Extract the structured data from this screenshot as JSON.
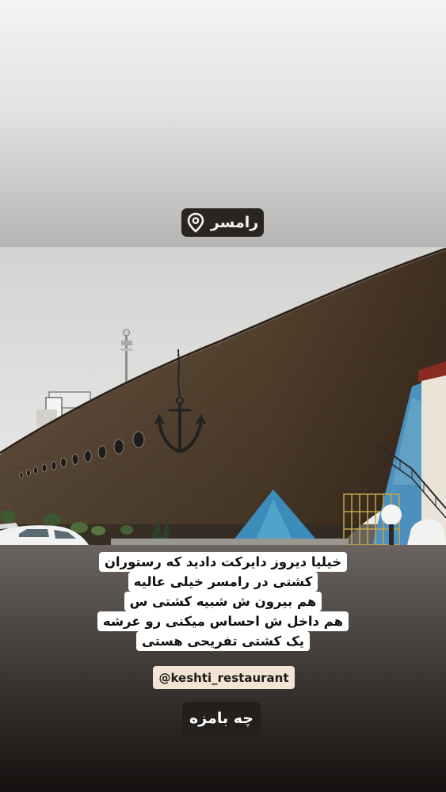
{
  "location_sticker": {
    "label": "رامسر",
    "icon": "location-pin-icon"
  },
  "caption": {
    "lines": [
      "خیلیا دیروز دایرکت دادید که رستوران",
      "کشتی در رامسر خیلی عالیه",
      "هم بیرون ش شبیه کشتی س",
      "هم داخل ش احساس میکنی رو عرشه",
      "یک کشتی تفریحی هستی"
    ]
  },
  "mention_sticker": {
    "label": "@keshti_restaurant"
  },
  "reply_text": {
    "label": "چه بامزه"
  },
  "colors": {
    "ship_hull": "#5b4836",
    "sky": "#dcdcdb",
    "mural_blue": "#3b86b6",
    "mention_bg": "#f3e5d3"
  }
}
